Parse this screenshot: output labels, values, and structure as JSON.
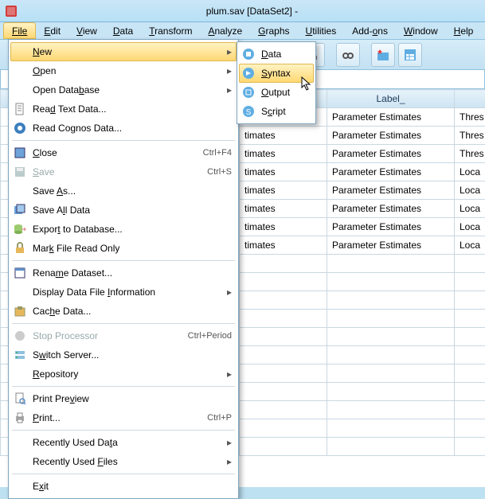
{
  "titlebar": {
    "title": "plum.sav [DataSet2] -"
  },
  "menubar": {
    "file": "File",
    "edit": "Edit",
    "view": "View",
    "data": "Data",
    "transform": "Transform",
    "analyze": "Analyze",
    "graphs": "Graphs",
    "utilities": "Utilities",
    "addons": "Add-ons",
    "window": "Window",
    "help": "Help"
  },
  "file_menu": {
    "new": "New",
    "open": "Open",
    "open_db": "Open Database",
    "read_text": "Read Text Data...",
    "read_cognos": "Read Cognos Data...",
    "close": "Close",
    "close_sc": "Ctrl+F4",
    "save": "Save",
    "save_sc": "Ctrl+S",
    "save_as": "Save As...",
    "save_all": "Save All Data",
    "export_db": "Export to Database...",
    "mark_ro": "Mark File Read Only",
    "rename_ds": "Rename Dataset...",
    "display_info": "Display Data File Information",
    "cache": "Cache Data...",
    "stop_proc": "Stop Processor",
    "stop_sc": "Ctrl+Period",
    "switch_srv": "Switch Server...",
    "repository": "Repository",
    "print_preview": "Print Preview",
    "print": "Print...",
    "print_sc": "Ctrl+P",
    "recent_data": "Recently Used Data",
    "recent_files": "Recently Used Files",
    "exit": "Exit"
  },
  "new_submenu": {
    "data": "Data",
    "syntax": "Syntax",
    "output": "Output",
    "script": "Script"
  },
  "grid": {
    "headers": {
      "col3": "Label_"
    },
    "col1_partial": "timates",
    "col2": "Parameter Estimates",
    "col3_a": "Thres",
    "col3_b": "Loca"
  }
}
